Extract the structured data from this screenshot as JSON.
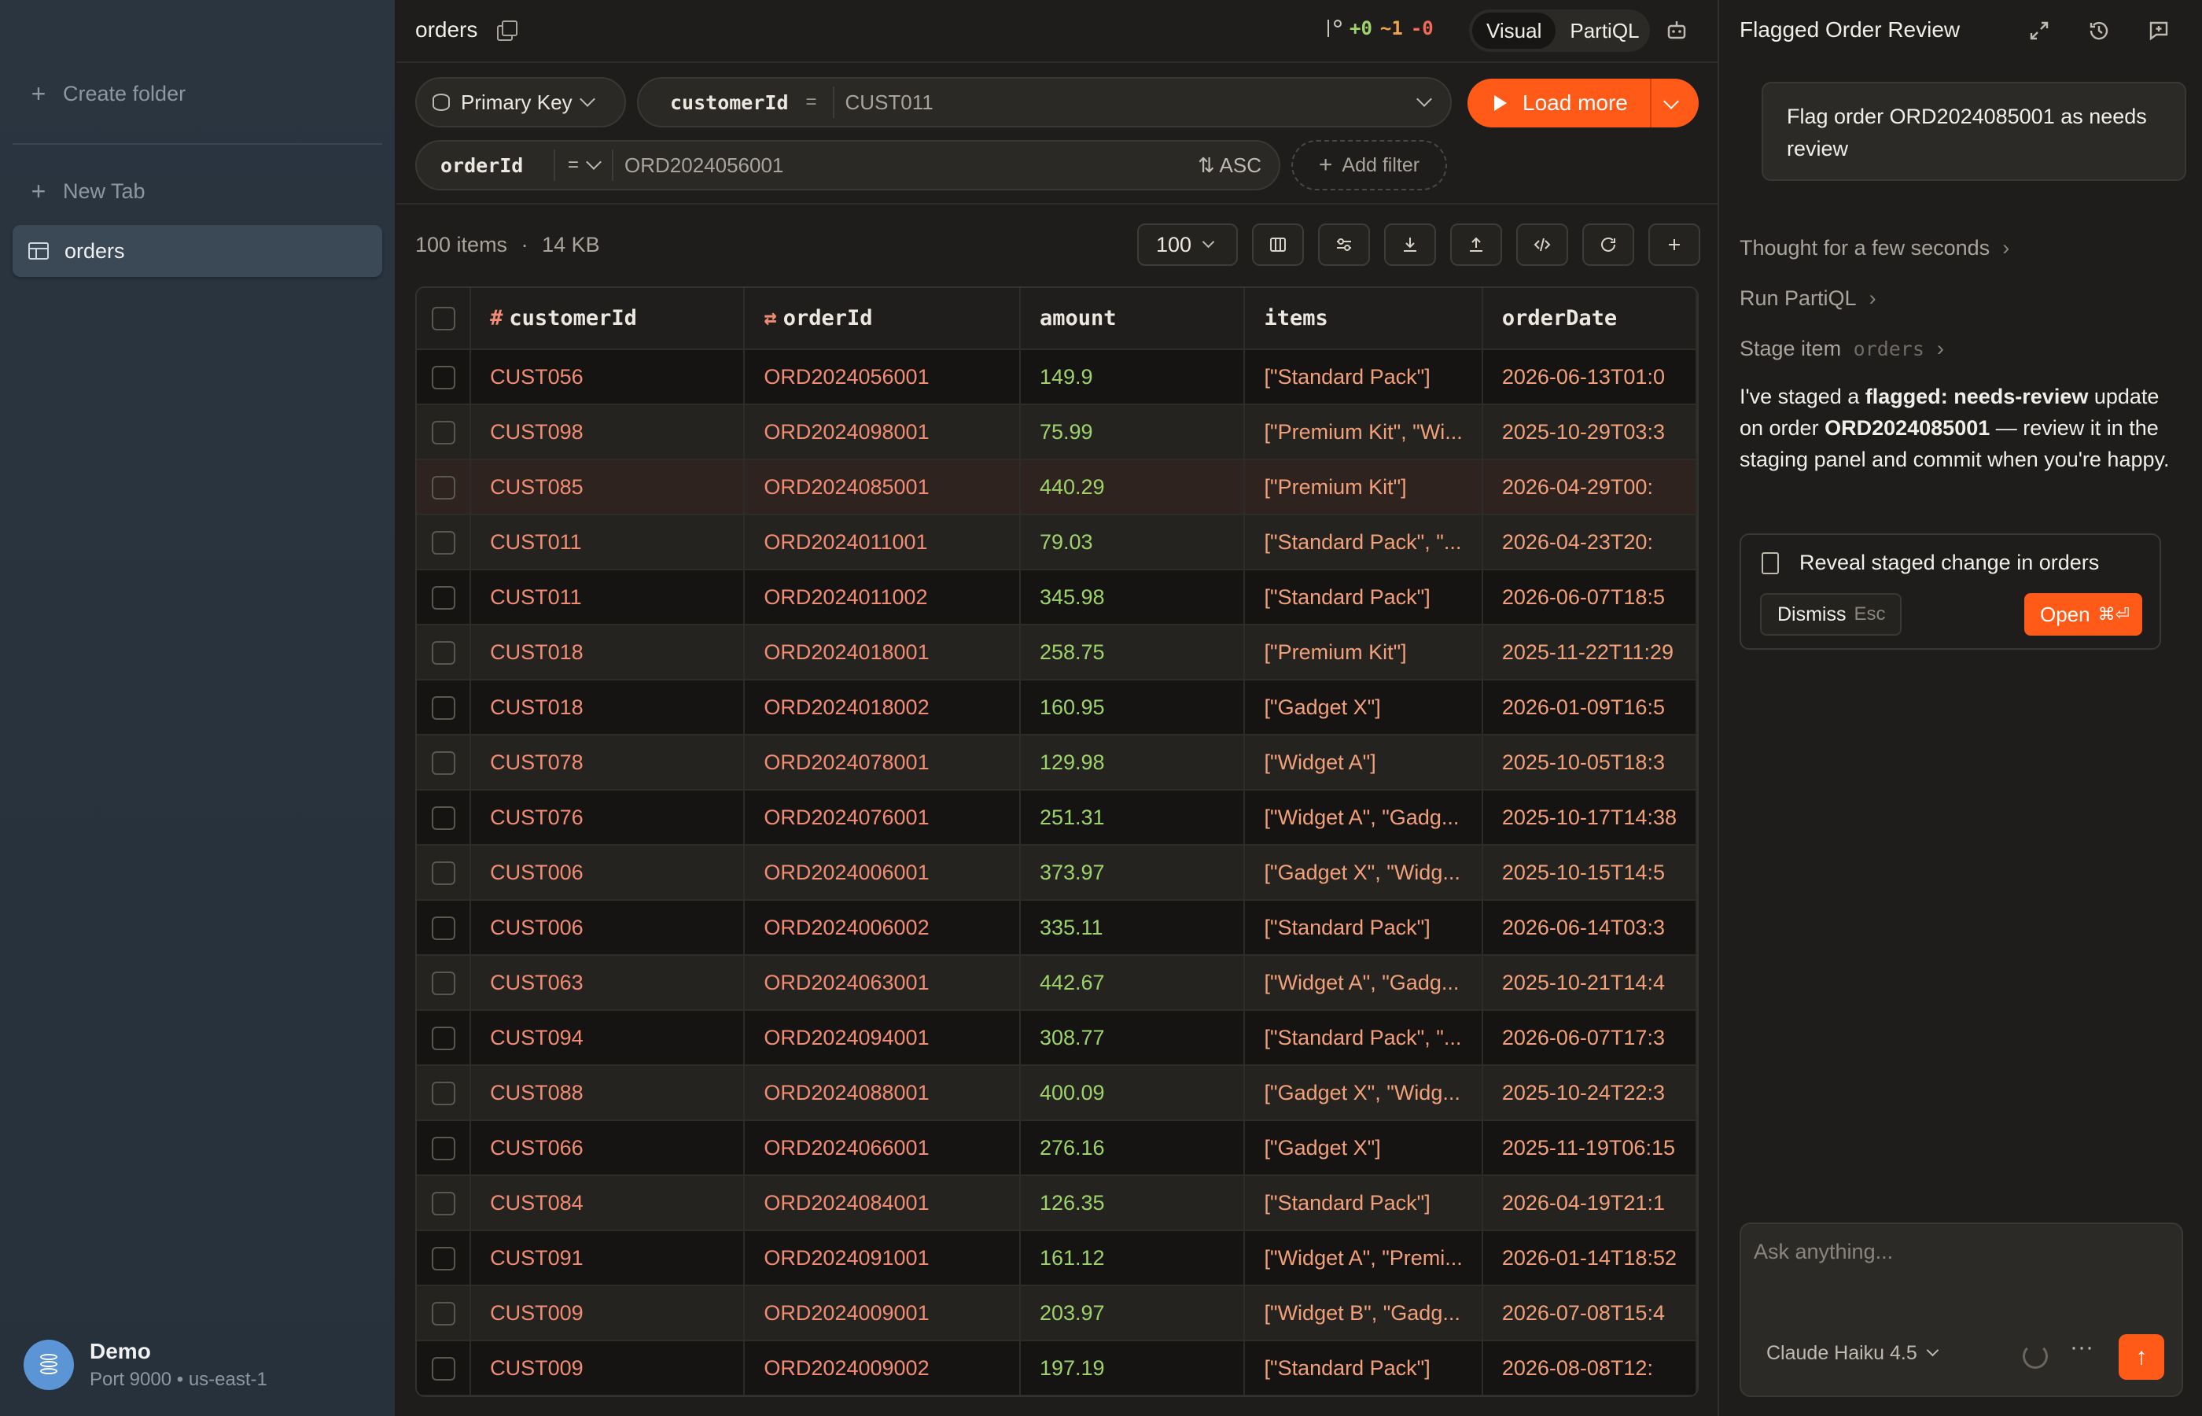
{
  "sidebar": {
    "create_folder": "Create folder",
    "new_tab": "New Tab",
    "active_tab": "orders",
    "connection": {
      "name": "Demo",
      "detail": "Port 9000 • us-east-1"
    }
  },
  "header": {
    "table_name": "orders",
    "diff_added": "+0",
    "diff_modified": "~1",
    "diff_removed": "-0",
    "mode_visual": "Visual",
    "mode_partiql": "PartiQL"
  },
  "filters": {
    "index_label": "Primary Key",
    "pk_key": "customerId",
    "pk_op": "=",
    "pk_value": "CUST011",
    "load_more": "Load more",
    "sk_key": "orderId",
    "sk_op": "=",
    "sk_value": "ORD2024056001",
    "sort": "ASC",
    "add_filter": "Add filter"
  },
  "toolbar": {
    "count": "100 items",
    "size": "14 KB",
    "page_size": "100"
  },
  "table": {
    "columns": [
      "customerId",
      "orderId",
      "amount",
      "items",
      "orderDate"
    ],
    "rows": [
      [
        "CUST056",
        "ORD2024056001",
        "149.9",
        "[\"Standard Pack\"]",
        "2026-06-13T01:0"
      ],
      [
        "CUST098",
        "ORD2024098001",
        "75.99",
        "[\"Premium Kit\", \"Wi...",
        "2025-10-29T03:3"
      ],
      [
        "CUST085",
        "ORD2024085001",
        "440.29",
        "[\"Premium Kit\"]",
        "2026-04-29T00:"
      ],
      [
        "CUST011",
        "ORD2024011001",
        "79.03",
        "[\"Standard Pack\", \"...",
        "2026-04-23T20:"
      ],
      [
        "CUST011",
        "ORD2024011002",
        "345.98",
        "[\"Standard Pack\"]",
        "2026-06-07T18:5"
      ],
      [
        "CUST018",
        "ORD2024018001",
        "258.75",
        "[\"Premium Kit\"]",
        "2025-11-22T11:29"
      ],
      [
        "CUST018",
        "ORD2024018002",
        "160.95",
        "[\"Gadget X\"]",
        "2026-01-09T16:5"
      ],
      [
        "CUST078",
        "ORD2024078001",
        "129.98",
        "[\"Widget A\"]",
        "2025-10-05T18:3"
      ],
      [
        "CUST076",
        "ORD2024076001",
        "251.31",
        "[\"Widget A\", \"Gadg...",
        "2025-10-17T14:38"
      ],
      [
        "CUST006",
        "ORD2024006001",
        "373.97",
        "[\"Gadget X\", \"Widg...",
        "2025-10-15T14:5"
      ],
      [
        "CUST006",
        "ORD2024006002",
        "335.11",
        "[\"Standard Pack\"]",
        "2026-06-14T03:3"
      ],
      [
        "CUST063",
        "ORD2024063001",
        "442.67",
        "[\"Widget A\", \"Gadg...",
        "2025-10-21T14:4"
      ],
      [
        "CUST094",
        "ORD2024094001",
        "308.77",
        "[\"Standard Pack\", \"...",
        "2026-06-07T17:3"
      ],
      [
        "CUST088",
        "ORD2024088001",
        "400.09",
        "[\"Gadget X\", \"Widg...",
        "2025-10-24T22:3"
      ],
      [
        "CUST066",
        "ORD2024066001",
        "276.16",
        "[\"Gadget X\"]",
        "2025-11-19T06:15"
      ],
      [
        "CUST084",
        "ORD2024084001",
        "126.35",
        "[\"Standard Pack\"]",
        "2026-04-19T21:1"
      ],
      [
        "CUST091",
        "ORD2024091001",
        "161.12",
        "[\"Widget A\", \"Premi...",
        "2026-01-14T18:52"
      ],
      [
        "CUST009",
        "ORD2024009001",
        "203.97",
        "[\"Widget B\", \"Gadg...",
        "2026-07-08T15:4"
      ],
      [
        "CUST009",
        "ORD2024009002",
        "197.19",
        "[\"Standard Pack\"]",
        "2026-08-08T12:"
      ]
    ],
    "highlight_row": 2
  },
  "panel": {
    "title": "Flagged Order Review",
    "user_message": "Flag order ORD2024085001 as needs review",
    "step_thought": "Thought for a few seconds",
    "step_run": "Run PartiQL",
    "step_stage": "Stage item",
    "step_stage_table": "orders",
    "reply_1": "I've staged a ",
    "reply_bold_1": "flagged: needs-review",
    "reply_2": " update on order ",
    "reply_bold_2": "ORD2024085001",
    "reply_3": " — review it in the staging panel and commit when you're happy.",
    "reveal_text": "Reveal staged change in orders",
    "dismiss": "Dismiss",
    "dismiss_key": "Esc",
    "open": "Open",
    "open_key": "⌘⏎",
    "composer_placeholder": "Ask anything...",
    "model": "Claude Haiku 4.5"
  },
  "colors": {
    "accent": "#ff5a17",
    "key_text": "#f28c73",
    "number_text": "#9ed36a",
    "diff_added": "#9ed36a",
    "diff_modified": "#f0a34a",
    "diff_removed": "#f06a5a"
  }
}
